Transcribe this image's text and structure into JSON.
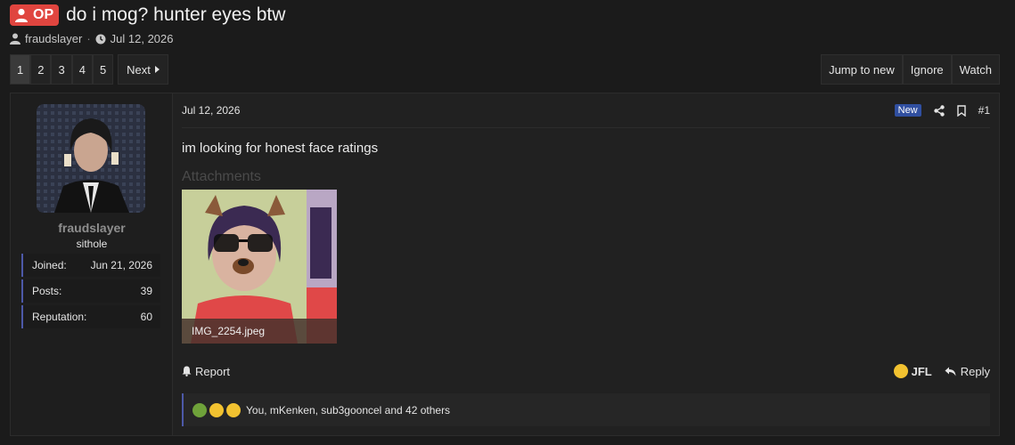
{
  "thread": {
    "op_label": "OP",
    "title": "do i mog? hunter eyes btw",
    "author": "fraudslayer",
    "separator": "·",
    "date": "Jul 12, 2026"
  },
  "pagination": {
    "pages": [
      "1",
      "2",
      "3",
      "4",
      "5"
    ],
    "current": "1",
    "next_label": "Next"
  },
  "thread_actions": {
    "jump_label": "Jump to new",
    "ignore_label": "Ignore",
    "watch_label": "Watch"
  },
  "post": {
    "user": {
      "name": "fraudslayer",
      "title": "sithole",
      "stats": [
        {
          "label": "Joined:",
          "value": "Jun 21, 2026"
        },
        {
          "label": "Posts:",
          "value": "39"
        },
        {
          "label": "Reputation:",
          "value": "60"
        }
      ]
    },
    "date": "Jul 12, 2026",
    "new_badge": "New",
    "number": "#1",
    "body": "im looking for honest face ratings",
    "attachments_label": "Attachments",
    "attachment_filename": "IMG_2254.jpeg",
    "report_label": "Report",
    "reaction_label": "JFL",
    "reply_label": "Reply",
    "reactions_summary": "You, mKenken, sub3gooncel and 42 others"
  },
  "colors": {
    "background": "#1b1b1b",
    "op_badge": "#e0453f",
    "accent": "#4d59a8",
    "new_badge": "#304fa0"
  }
}
